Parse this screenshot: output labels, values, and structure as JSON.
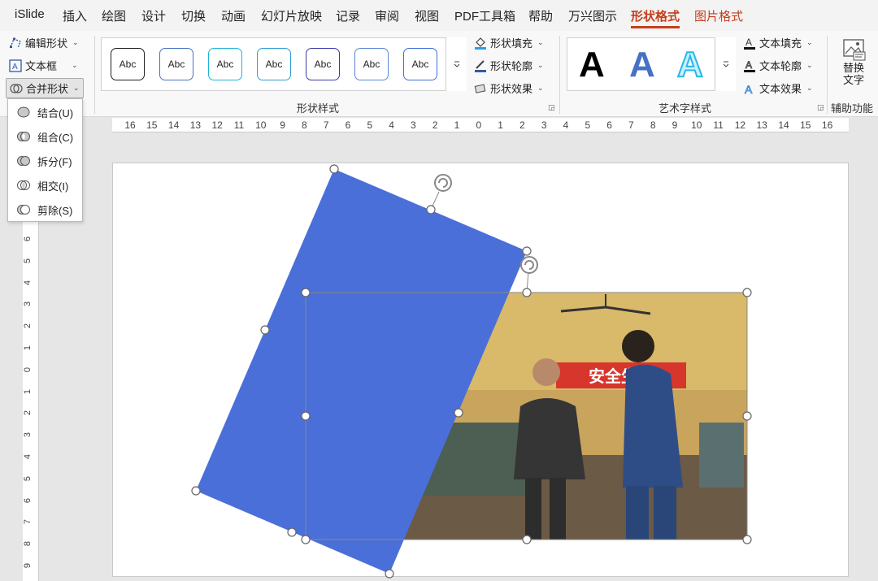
{
  "tabs": [
    "iSlide",
    "插入",
    "绘图",
    "设计",
    "切换",
    "动画",
    "幻灯片放映",
    "记录",
    "审阅",
    "视图",
    "PDF工具箱",
    "帮助",
    "万兴图示",
    "形状格式",
    "图片格式"
  ],
  "left_tools": {
    "edit_shape": "编辑形状",
    "text_box": "文本框",
    "merge_shapes": "合并形状"
  },
  "merge_menu": [
    {
      "label": "结合(U)",
      "icon": "union-icon"
    },
    {
      "label": "组合(C)",
      "icon": "combine-icon"
    },
    {
      "label": "拆分(F)",
      "icon": "fragment-icon"
    },
    {
      "label": "相交(I)",
      "icon": "intersect-icon"
    },
    {
      "label": "剪除(S)",
      "icon": "subtract-icon"
    }
  ],
  "shape_styles": {
    "sample_text": "Abc",
    "border_colors": [
      "#1f1f1f",
      "#4472c4",
      "#1fb3d9",
      "#2e9cd6",
      "#3a3aa8",
      "#5a87d8",
      "#3f6fd8"
    ],
    "fill": "形状填充",
    "outline": "形状轮廓",
    "effects": "形状效果",
    "group_label": "形状样式"
  },
  "wordart": {
    "letter": "A",
    "colors": [
      "#000000",
      "#4472c4",
      "#2ab6e8"
    ],
    "fill": "文本填充",
    "outline": "文本轮廓",
    "effects": "文本效果",
    "group_label": "艺术字样式"
  },
  "alt_text": {
    "line1": "替换",
    "line2": "文字",
    "group_label": "辅助功能"
  },
  "ruler_h": [
    "16",
    "15",
    "14",
    "13",
    "12",
    "11",
    "10",
    "9",
    "8",
    "7",
    "6",
    "5",
    "4",
    "3",
    "2",
    "1",
    "0",
    "1",
    "2",
    "3",
    "4",
    "5",
    "6",
    "7",
    "8",
    "9",
    "10",
    "11",
    "12",
    "13",
    "14",
    "15",
    "16"
  ],
  "ruler_v": [
    "6",
    "5",
    "4",
    "3",
    "2",
    "1",
    "0",
    "1",
    "2",
    "3",
    "4",
    "5",
    "6",
    "7",
    "8",
    "9"
  ],
  "slide": {
    "shape_color": "#4a6fd9",
    "banner_text": "安全生产"
  }
}
